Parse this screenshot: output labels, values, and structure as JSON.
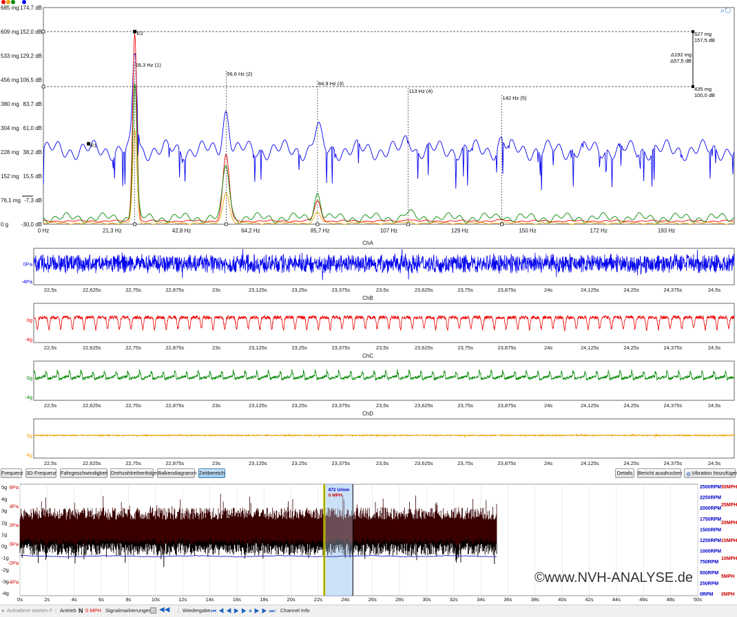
{
  "colors": {
    "chA": "#0000ee",
    "chB": "#ee0000",
    "chC": "#008800",
    "chD": "#f0a000",
    "overviewWave": "#3a0000",
    "selection": "#cce4f7",
    "cursor": "#e8e800",
    "rpmAxis": "#0000cc",
    "mphAxis": "#cc0000"
  },
  "legend_dots": [
    "#ee0000",
    "#f0a000",
    "#008800",
    "#0000ee"
  ],
  "chart_data": [
    {
      "type": "line",
      "name": "spectrum",
      "y_labels_mg": [
        "685 mg",
        "609 mg",
        "533 mg",
        "456 mg",
        "380 mg",
        "304 mg",
        "228 mg",
        "152 mg",
        "76,1 mg",
        "0 g"
      ],
      "y_labels_db": [
        "174,7 dB",
        "152,0 dB",
        "129,2 dB",
        "106,5 dB",
        "83,7 dB",
        "61,0 dB",
        "38,2 dB",
        "15,5 dB",
        "-7,3 dB",
        "-30,0 dB"
      ],
      "ylim_db": [
        -30,
        174.7
      ],
      "x_ticks": [
        "0 Hz",
        "21,3 Hz",
        "42,8 Hz",
        "64,2 Hz",
        "85,7 Hz",
        "107 Hz",
        "129 Hz",
        "150 Hz",
        "172 Hz",
        "193 Hz"
      ],
      "x_tick_values": [
        0,
        21.3,
        42.8,
        64.2,
        85.7,
        107,
        129,
        150,
        172,
        193
      ],
      "xlim": [
        0,
        214
      ],
      "peaks": [
        {
          "label": "28,3 Hz (1)",
          "x": 28.3
        },
        {
          "label": "56,6 Hz (2)",
          "x": 56.6
        },
        {
          "label": "84,9 Hz (3)",
          "x": 84.9
        },
        {
          "label": "113 Hz (4)",
          "x": 113
        },
        {
          "label": "142 Hz (5)",
          "x": 142
        }
      ],
      "markers": [
        {
          "label": "E2",
          "x": 28.3,
          "y_db": 152.0
        },
        {
          "label": "E1",
          "x": 14,
          "y_db": 46
        }
      ],
      "cursor_lines": [
        {
          "y_db": 152.0,
          "text1": "627 mg",
          "text2": "157,5 dB"
        },
        {
          "y_db": 100.0,
          "text1": "435 mg",
          "text2": "100,0 dB"
        }
      ],
      "delta": {
        "text1": "Δ192 mg",
        "text2": "Δ57,5 dB"
      },
      "series": [
        {
          "color_key": "chA",
          "baseline_db": 40,
          "peak_heights": [
            96,
            37,
            21,
            12,
            10
          ],
          "noise": 10
        },
        {
          "color_key": "chB",
          "baseline_db": -27,
          "peak_heights": [
            179,
            63,
            19,
            2,
            1
          ],
          "noise": 1
        },
        {
          "color_key": "chC",
          "baseline_db": -24,
          "peak_heights": [
            128,
            50,
            23,
            5,
            3
          ],
          "noise": 5
        },
        {
          "color_key": "chD",
          "baseline_db": -29,
          "peak_heights": [
            88,
            30,
            10,
            1,
            1
          ],
          "noise": 1
        }
      ]
    },
    {
      "type": "line",
      "name": "time-signals",
      "x_ticks": [
        "22,5s",
        "22,625s",
        "22,75s",
        "22,875s",
        "23s",
        "23,125s",
        "23,25s",
        "23,375s",
        "23,5s",
        "23,625s",
        "23,75s",
        "23,875s",
        "24s",
        "24,125s",
        "24,25s",
        "24,375s",
        "24,5s"
      ],
      "x_tick_values": [
        22.5,
        22.625,
        22.75,
        22.875,
        23.0,
        23.125,
        23.25,
        23.375,
        23.5,
        23.625,
        23.75,
        23.875,
        24.0,
        24.125,
        24.25,
        24.375,
        24.5
      ],
      "xlim": [
        22.45,
        24.56
      ],
      "channels": [
        {
          "title": "ChA",
          "color_key": "chA",
          "y_zero": "0Pa",
          "y_low": "-4Pa",
          "shape": "noise",
          "amp": 0.55
        },
        {
          "title": "ChB",
          "color_key": "chB",
          "y_zero": "0g",
          "y_low": "-4g",
          "shape": "dip",
          "amp": 0.5
        },
        {
          "title": "ChC",
          "color_key": "chC",
          "y_zero": "0g",
          "y_low": "-4g",
          "shape": "saw",
          "amp": 0.45
        },
        {
          "title": "ChD",
          "color_key": "chD",
          "y_zero": "0g",
          "y_low": "-4g",
          "shape": "flat",
          "amp": 0.12
        }
      ],
      "period_s": 0.0353
    },
    {
      "type": "area",
      "name": "overview",
      "x_ticks": [
        "0s",
        "2s",
        "4s",
        "6s",
        "8s",
        "10s",
        "12s",
        "14s",
        "16s",
        "18s",
        "20s",
        "22s",
        "24s",
        "26s",
        "28s",
        "30s",
        "32s",
        "34s",
        "36s",
        "38s",
        "40s",
        "42s",
        "44s",
        "46s",
        "48s",
        "50s"
      ],
      "xlim": [
        0,
        50
      ],
      "data_end_s": 35.2,
      "y_left_g": [
        "5g",
        "4g",
        "3g",
        "2g",
        "1g",
        "0g",
        "-1g",
        "-2g",
        "-3g",
        "-4g"
      ],
      "y_left_pa": [
        "6Pa",
        "4Pa",
        "2Pa",
        "0Pa",
        "-2Pa",
        "-4Pa"
      ],
      "y_right_rpm": [
        "2500RPM",
        "2250RPM",
        "2000RPM",
        "1750RPM",
        "1500RPM",
        "1250RPM",
        "1000RPM",
        "750RPM",
        "500RPM",
        "250RPM",
        "0RPM"
      ],
      "y_right_mph": [
        "30MPH",
        "25MPH",
        "20MPH",
        "15MPH",
        "10MPH",
        "5MPH",
        "0MPH"
      ],
      "rpm_level": 872,
      "selection_s": [
        22.45,
        24.56
      ],
      "cursor_s": 22.45,
      "rpm_label": "872 U/min",
      "mph_label": "0 MPH"
    }
  ],
  "toolbar": {
    "left": [
      "Frequenz",
      "3D-Frequenz",
      "Fahrgeschwindigkeit",
      "Drehzahlreihenfolge",
      "Balkendiagramm",
      "Zeitbereich"
    ],
    "right": [
      "Details",
      "Bericht ausdrucken",
      "Vibration hinzufügen"
    ]
  },
  "watermark": "©www.NVH-ANALYSE.de",
  "status": {
    "record": "Aufnahme starten",
    "drive": "Antrieb",
    "gear": "N",
    "speed": "0 MPH",
    "markers": "Signalmarkierungen",
    "playback": "Wiedergabe",
    "channel_info": "Channel Info"
  }
}
